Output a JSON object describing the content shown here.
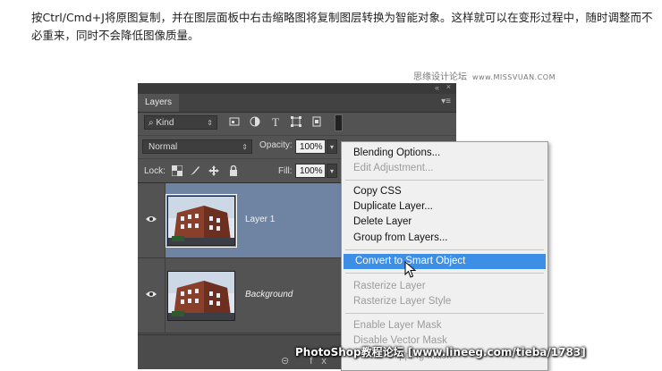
{
  "article": {
    "paragraph": "按Ctrl/Cmd+J将原图复制，并在图层面板中右击缩略图将复制图层转换为智能对象。这样就可以在变形过程中，随时调整而不必重来，同时不会降低图像质量。"
  },
  "watermark_top": {
    "site": "思缘设计论坛",
    "url": "www.MISSVUAN.COM"
  },
  "panel": {
    "tab_label": "Layers",
    "collapse_glyph": "«",
    "close_glyph": "×",
    "menu_glyph": "▾≡",
    "filter": {
      "kind_label": "Kind",
      "kind_arrow": "⇕",
      "search_icon": "⌕"
    },
    "blend_mode": "Normal",
    "blend_arrow": "⇕",
    "opacity_label": "Opacity:",
    "opacity_value": "100%",
    "lock_label": "Lock:",
    "fill_label": "Fill:",
    "fill_value": "100%",
    "dropdown_arrow": "▾",
    "layers": [
      {
        "name": "Layer 1",
        "selected": true,
        "visible": true
      },
      {
        "name": "Background",
        "selected": false,
        "visible": true
      }
    ],
    "bottom_icons": "⊝ fx ◘"
  },
  "context_menu": {
    "items": [
      {
        "label": "Blending Options...",
        "enabled": true
      },
      {
        "label": "Edit Adjustment...",
        "enabled": false
      },
      {
        "label": "Copy CSS",
        "enabled": true
      },
      {
        "label": "Duplicate Layer...",
        "enabled": true
      },
      {
        "label": "Delete Layer",
        "enabled": true
      },
      {
        "label": "Group from Layers...",
        "enabled": true
      },
      {
        "label": "Convert to Smart Object",
        "enabled": true,
        "highlighted": true
      },
      {
        "label": "Rasterize Layer",
        "enabled": false
      },
      {
        "label": "Rasterize Layer Style",
        "enabled": false
      },
      {
        "label": "Enable Layer Mask",
        "enabled": false
      },
      {
        "label": "Disable Vector Mask",
        "enabled": false
      },
      {
        "label": "Create Clipping Mask",
        "enabled": false
      }
    ]
  },
  "watermark_bottom": "PhotoShop教程论坛 [www.lineeg.com/tieba/1783]",
  "colors": {
    "panel_bg": "#535353",
    "selected_layer": "#6f84a3",
    "menu_highlight": "#3d8ee6",
    "menu_bg": "#f0f0f0"
  }
}
